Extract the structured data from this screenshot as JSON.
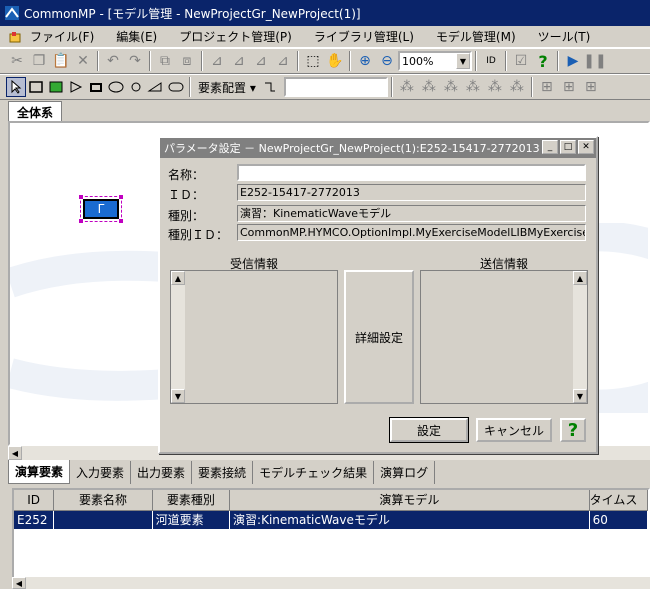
{
  "window": {
    "title": "CommonMP - [モデル管理 - NewProjectGr_NewProject(1)]"
  },
  "menu": [
    "ファイル(F)",
    "編集(E)",
    "プロジェクト管理(P)",
    "ライブラリ管理(L)",
    "モデル管理(M)",
    "ツール(T)"
  ],
  "toolbar": {
    "zoom": "100%",
    "element_layout": "要素配置 ▾",
    "id_label": "ID"
  },
  "canvas": {
    "tab": "全体系",
    "element_icon_label": "Γ"
  },
  "bottom_tabs": [
    "演算要素",
    "入力要素",
    "出力要素",
    "要素接続",
    "モデルチェック結果",
    "演算ログ"
  ],
  "grid": {
    "headers": [
      "ID",
      "要素名称",
      "要素種別",
      "演算モデル",
      "タイムス"
    ],
    "rows": [
      [
        "E252",
        "",
        "河道要素",
        "演習:KinematicWaveモデル",
        "60"
      ]
    ]
  },
  "dialog": {
    "title": "パラメータ設定 － NewProjectGr_NewProject(1):E252-15417-2772013",
    "name_label": "名称：",
    "name_value": "",
    "id_label": "ＩＤ：",
    "id_value": "E252-15417-2772013",
    "kind_label": "種別：",
    "kind_value": "演習：KinematicWaveモデル",
    "kindid_label": "種別ＩＤ：",
    "kindid_value": "CommonMP.HYMCO.OptionImpl.MyExerciseModelLIBMyExerciseModel",
    "recv_label": "受信情報",
    "send_label": "送信情報",
    "detail_button": "詳細設定",
    "ok_button": "設定",
    "cancel_button": "キャンセル",
    "help_button": "?"
  },
  "colors": {
    "title_active": "#0a246a",
    "title_inactive": "#808080",
    "face": "#d4d0c8",
    "help_green": "#008000"
  }
}
